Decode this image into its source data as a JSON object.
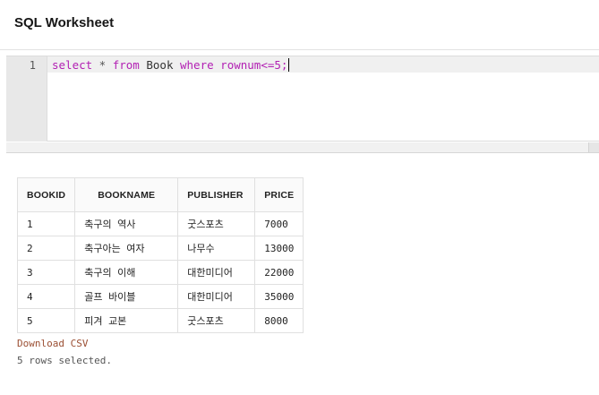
{
  "header": {
    "title": "SQL Worksheet"
  },
  "editor": {
    "line_number": "1",
    "tokens": {
      "select": "select",
      "star": " * ",
      "from": "from",
      "table": " Book ",
      "where": "where",
      "condition": " rownum<=5;"
    }
  },
  "results": {
    "columns": [
      "BOOKID",
      "BOOKNAME",
      "PUBLISHER",
      "PRICE"
    ],
    "rows": [
      [
        "1",
        "축구의 역사",
        "굿스포츠",
        "7000"
      ],
      [
        "2",
        "축구아는 여자",
        "나무수",
        "13000"
      ],
      [
        "3",
        "축구의 이해",
        "대한미디어",
        "22000"
      ],
      [
        "4",
        "골프 바이블",
        "대한미디어",
        "35000"
      ],
      [
        "5",
        "피겨 교본",
        "굿스포츠",
        "8000"
      ]
    ]
  },
  "footer": {
    "download_label": "Download CSV",
    "status": "5 rows selected."
  },
  "colors": {
    "keyword": "#b21fb3",
    "link": "#9b4f33"
  }
}
